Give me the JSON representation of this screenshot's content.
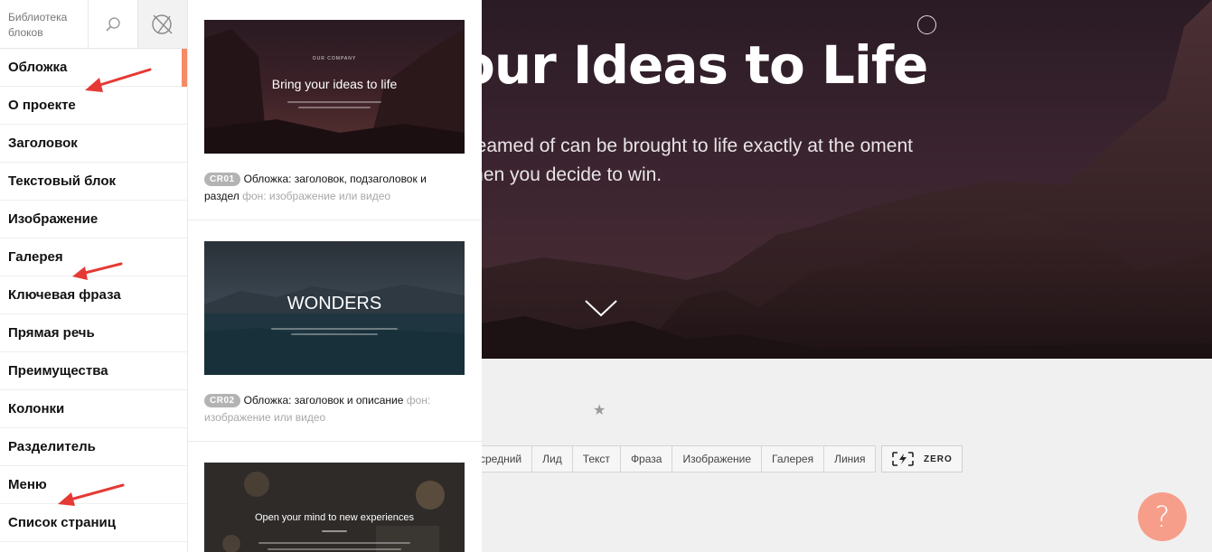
{
  "sidebar": {
    "title": "Библиотека блоков",
    "items": [
      {
        "label": "Обложка"
      },
      {
        "label": "О проекте"
      },
      {
        "label": "Заголовок"
      },
      {
        "label": "Текстовый блок"
      },
      {
        "label": "Изображение"
      },
      {
        "label": "Галерея"
      },
      {
        "label": "Ключевая фраза"
      },
      {
        "label": "Прямая речь"
      },
      {
        "label": "Преимущества"
      },
      {
        "label": "Колонки"
      },
      {
        "label": "Разделитель"
      },
      {
        "label": "Меню"
      },
      {
        "label": "Список страниц"
      }
    ],
    "icons": {
      "search": "search-icon",
      "close": "close-icon"
    },
    "accent_color": "#f58a66"
  },
  "catalog": {
    "cards": [
      {
        "thumb_kicker": "OUR COMPANY",
        "thumb_title": "Bring your ideas to life",
        "code": "CR01",
        "name": "Обложка: заголовок, подзаголовок и раздел",
        "bg_note": "фон: изображение или видео"
      },
      {
        "thumb_title": "WONDERS",
        "code": "CR02",
        "name": "Обложка: заголовок и описание",
        "bg_note": "фон: изображение или видео"
      },
      {
        "thumb_title": "Open your mind to new experiences"
      }
    ]
  },
  "hero": {
    "title": "our Ideas to Life",
    "subtitle": "dreamed of can be brought to life exactly at the oment when you decide to win."
  },
  "filters": [
    "средний",
    "Лид",
    "Текст",
    "Фраза",
    "Изображение",
    "Галерея",
    "Линия"
  ],
  "zero_label": "ZERO",
  "help_label": "?",
  "colors": {
    "help_button": "#f79e8a",
    "annotation_arrow": "#e53935"
  }
}
